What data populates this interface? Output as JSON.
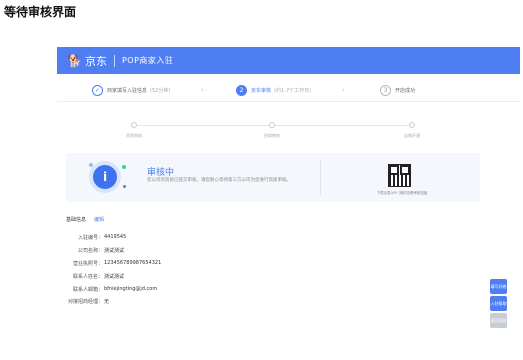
{
  "page_heading": "等待审核界面",
  "header": {
    "logo_text": "京东",
    "title": "POP商家入驻"
  },
  "steps": [
    {
      "number": "✓",
      "label": "商家填写入驻信息",
      "sub": "(52分钟)"
    },
    {
      "number": "2",
      "label": "京东审核",
      "sub": "(约1-7个工作日)"
    },
    {
      "number": "3",
      "label": "开店成功",
      "sub": ""
    }
  ],
  "progress": {
    "labels": [
      "资质审核",
      "招商审核",
      "店铺开通"
    ]
  },
  "status": {
    "title": "审核中",
    "description": "您公司的资质已提交审核，请您耐心等待第三方公司为您进行资质审核。",
    "qr_caption": "下载京麦APP, 随时查看审核进度"
  },
  "basic_info": {
    "title": "基础信息",
    "edit_label": "编辑",
    "rows": [
      {
        "label": "入驻编号：",
        "value": "4419545"
      },
      {
        "label": "公司名称：",
        "value": "测试测试"
      },
      {
        "label": "营业执照号：",
        "value": "123456789987654321"
      },
      {
        "label": "联系人姓名：",
        "value": "测试测试"
      },
      {
        "label": "联系人邮箱：",
        "value": "bfniejingting@jd.com"
      },
      {
        "label": "对接招商经理：",
        "value": "无"
      }
    ]
  },
  "float_buttons": [
    {
      "label": "填写问卷"
    },
    {
      "label": "入驻帮助"
    },
    {
      "label": "返回顶部"
    }
  ],
  "colors": {
    "accent": "#4f7ef3",
    "status_bg": "#f4f7fc"
  }
}
